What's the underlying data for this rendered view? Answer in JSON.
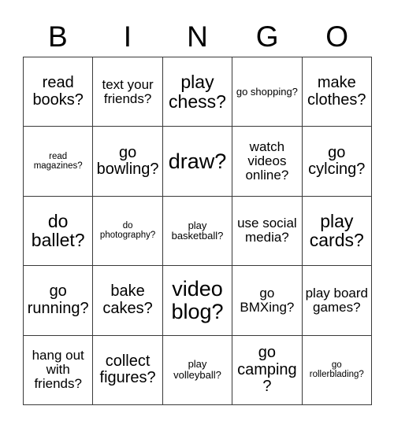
{
  "card": {
    "title": "BINGO card",
    "header_letters": [
      "B",
      "I",
      "N",
      "G",
      "O"
    ],
    "columns": 5,
    "rows": 5,
    "border_color": "#3a3a3a",
    "text_color": "#000000",
    "background_color": "#ffffff",
    "cells": [
      {
        "text": "read books?",
        "size": "md"
      },
      {
        "text": "text your friends?",
        "size": "sm"
      },
      {
        "text": "play chess?",
        "size": "lg"
      },
      {
        "text": "go shopping?",
        "size": "xs"
      },
      {
        "text": "make clothes?",
        "size": "md"
      },
      {
        "text": "read magazines?",
        "size": "xxs"
      },
      {
        "text": "go bowling?",
        "size": "md"
      },
      {
        "text": "draw?",
        "size": "xl"
      },
      {
        "text": "watch videos online?",
        "size": "sm"
      },
      {
        "text": "go cylcing?",
        "size": "md"
      },
      {
        "text": "do ballet?",
        "size": "lg"
      },
      {
        "text": "do photography?",
        "size": "xxs"
      },
      {
        "text": "play basketball?",
        "size": "xs"
      },
      {
        "text": "use social media?",
        "size": "sm"
      },
      {
        "text": "play cards?",
        "size": "lg"
      },
      {
        "text": "go running?",
        "size": "md"
      },
      {
        "text": "bake cakes?",
        "size": "md"
      },
      {
        "text": "video blog?",
        "size": "xl"
      },
      {
        "text": "go BMXing?",
        "size": "sm"
      },
      {
        "text": "play board games?",
        "size": "sm"
      },
      {
        "text": "hang out with friends?",
        "size": "sm"
      },
      {
        "text": "collect figures?",
        "size": "md"
      },
      {
        "text": "play volleyball?",
        "size": "xs"
      },
      {
        "text": "go camping?",
        "size": "md"
      },
      {
        "text": "go rollerblading?",
        "size": "xxs"
      }
    ]
  }
}
